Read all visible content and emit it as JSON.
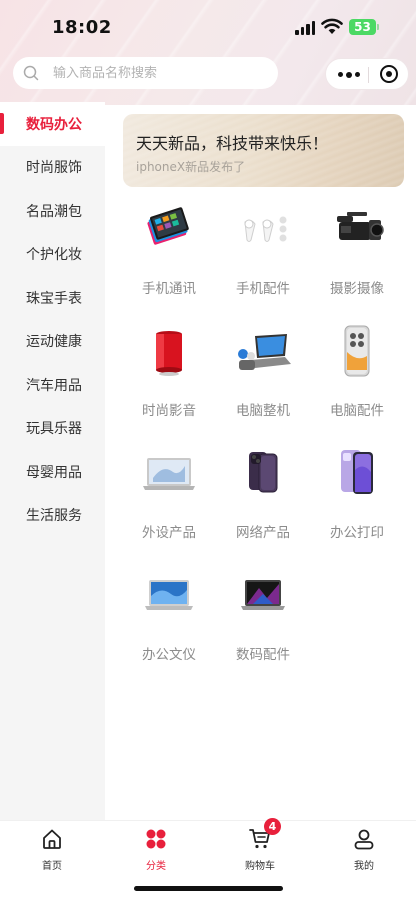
{
  "status_bar": {
    "time": "18:02",
    "battery": "53"
  },
  "search": {
    "placeholder": "输入商品名称搜索"
  },
  "sidebar": {
    "items": [
      {
        "label": "数码办公",
        "active": true
      },
      {
        "label": "时尚服饰"
      },
      {
        "label": "名品潮包"
      },
      {
        "label": "个护化妆"
      },
      {
        "label": "珠宝手表"
      },
      {
        "label": "运动健康"
      },
      {
        "label": "汽车用品"
      },
      {
        "label": "玩具乐器"
      },
      {
        "label": "母婴用品"
      },
      {
        "label": "生活服务"
      }
    ]
  },
  "banner": {
    "title": "天天新品，科技带来快乐！",
    "subtitle": "iphoneX新品发布了"
  },
  "categories": [
    {
      "label": "手机通讯",
      "icon": "tablet-icon"
    },
    {
      "label": "手机配件",
      "icon": "earbuds-icon"
    },
    {
      "label": "摄影摄像",
      "icon": "camcorder-icon"
    },
    {
      "label": "时尚影音",
      "icon": "speaker-icon"
    },
    {
      "label": "电脑整机",
      "icon": "laptop-icon"
    },
    {
      "label": "电脑配件",
      "icon": "smartphone-icon"
    },
    {
      "label": "外设产品",
      "icon": "laptop-silver-icon"
    },
    {
      "label": "网络产品",
      "icon": "iphone-icon"
    },
    {
      "label": "办公打印",
      "icon": "phone-purple-icon"
    },
    {
      "label": "办公文仪",
      "icon": "macbook-blue-icon"
    },
    {
      "label": "数码配件",
      "icon": "macbook-dark-icon"
    }
  ],
  "tabbar": {
    "tabs": [
      {
        "label": "首页",
        "icon": "home-icon"
      },
      {
        "label": "分类",
        "icon": "category-icon",
        "active": true
      },
      {
        "label": "购物车",
        "icon": "cart-icon"
      },
      {
        "label": "我的",
        "icon": "user-icon"
      }
    ],
    "cart_badge": "4"
  },
  "colors": {
    "accent": "#e8203c",
    "sidebar_bg": "#f5f5f5",
    "label_gray": "#8c8c8c"
  }
}
